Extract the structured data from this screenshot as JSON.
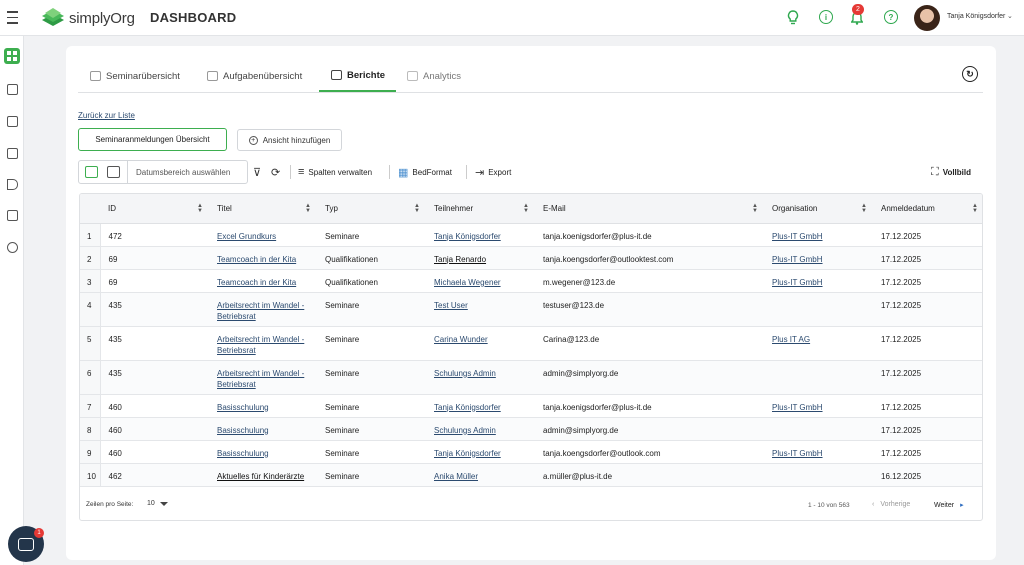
{
  "app": {
    "brand": "simplyOrg",
    "page_title": "DASHBOARD"
  },
  "header": {
    "notification_count": "2",
    "user_name": "Tanja Königsdorfer",
    "info_glyph": "i",
    "help_glyph": "?",
    "icons": [
      "lightbulb-icon",
      "info-icon",
      "bell-icon",
      "help-icon"
    ]
  },
  "sidebar": {
    "icons": [
      "dashboard-icon",
      "contacts-icon",
      "building-icon",
      "calendar-icon",
      "megaphone-icon",
      "table-icon",
      "settings-icon"
    ],
    "active": "dashboard-icon"
  },
  "chat": {
    "badge": "1"
  },
  "tabs": [
    {
      "label": "Seminarübersicht"
    },
    {
      "label": "Aufgabenübersicht"
    },
    {
      "label": "Berichte"
    },
    {
      "label": "Analytics"
    }
  ],
  "actions": {
    "back_link": "Zurück zur Liste",
    "view_button": "Seminaranmeldungen Übersicht",
    "add_view_button": "Ansicht hinzufügen"
  },
  "toolbar": {
    "date_placeholder": "Datumsbereich auswählen",
    "columns": "Spalten verwalten",
    "bedformat": "BedFormat",
    "export": "Export",
    "fullscreen": "Vollbild"
  },
  "table": {
    "columns": [
      "ID",
      "Titel",
      "Typ",
      "Teilnehmer",
      "E-Mail",
      "Organisation",
      "Anmeldedatum"
    ],
    "rows": [
      {
        "n": "1",
        "id": "472",
        "titel": [
          "Excel Grundkurs"
        ],
        "typ": "Seminare",
        "teilnehmer": "Tanja Königsdorfer",
        "email": "tanja.koenigsdorfer@plus-it.de",
        "org": "Plus-IT GmbH",
        "datum": "17.12.2025"
      },
      {
        "n": "2",
        "id": "69",
        "titel": [
          "Teamcoach in der Kita"
        ],
        "typ": "Qualifikationen",
        "teilnehmer": "Tanja Renardo",
        "email": "tanja.koengsdorfer@outlooktest.com",
        "org": "Plus-IT GmbH",
        "datum": "17.12.2025"
      },
      {
        "n": "3",
        "id": "69",
        "titel": [
          "Teamcoach in der Kita"
        ],
        "typ": "Qualifikationen",
        "teilnehmer": "Michaela Wegener",
        "email": "m.wegener@123.de",
        "org": "Plus-IT GmbH",
        "datum": "17.12.2025"
      },
      {
        "n": "4",
        "id": "435",
        "titel": [
          "Arbeitsrecht im Wandel -",
          "Betriebsrat"
        ],
        "typ": "Seminare",
        "teilnehmer": "Test User",
        "email": "testuser@123.de",
        "org": "",
        "datum": "17.12.2025"
      },
      {
        "n": "5",
        "id": "435",
        "titel": [
          "Arbeitsrecht im Wandel -",
          "Betriebsrat"
        ],
        "typ": "Seminare",
        "teilnehmer": "Carina Wunder",
        "email": "Carina@123.de",
        "org": "Plus IT AG",
        "datum": "17.12.2025"
      },
      {
        "n": "6",
        "id": "435",
        "titel": [
          "Arbeitsrecht im Wandel -",
          "Betriebsrat"
        ],
        "typ": "Seminare",
        "teilnehmer": "Schulungs Admin",
        "email": "admin@simplyorg.de",
        "org": "",
        "datum": "17.12.2025"
      },
      {
        "n": "7",
        "id": "460",
        "titel": [
          "Basisschulung"
        ],
        "typ": "Seminare",
        "teilnehmer": "Tanja Königsdorfer",
        "email": "tanja.koenigsdorfer@plus-it.de",
        "org": "Plus-IT GmbH",
        "datum": "17.12.2025"
      },
      {
        "n": "8",
        "id": "460",
        "titel": [
          "Basisschulung"
        ],
        "typ": "Seminare",
        "teilnehmer": "Schulungs Admin",
        "email": "admin@simplyorg.de",
        "org": "",
        "datum": "17.12.2025"
      },
      {
        "n": "9",
        "id": "460",
        "titel": [
          "Basisschulung"
        ],
        "typ": "Seminare",
        "teilnehmer": "Tanja Königsdorfer",
        "email": "tanja.koengsdorfer@outlook.com",
        "org": "Plus-IT GmbH",
        "datum": "17.12.2025"
      },
      {
        "n": "10",
        "id": "462",
        "titel": [
          "Aktuelles für Kinderärzte"
        ],
        "typ": "Seminare",
        "teilnehmer": "Anika Müller",
        "email": "a.müller@plus-it.de",
        "org": "",
        "datum": "16.12.2025"
      }
    ]
  },
  "pagination": {
    "rows_label": "Zeilen pro Seite:",
    "rows_value": "10",
    "range": "1 - 10 von 563",
    "prev": "Vorherige",
    "next": "Weiter"
  },
  "colors": {
    "accent": "#3dae4f",
    "link": "#2b4a6f",
    "badge": "#e53935"
  }
}
